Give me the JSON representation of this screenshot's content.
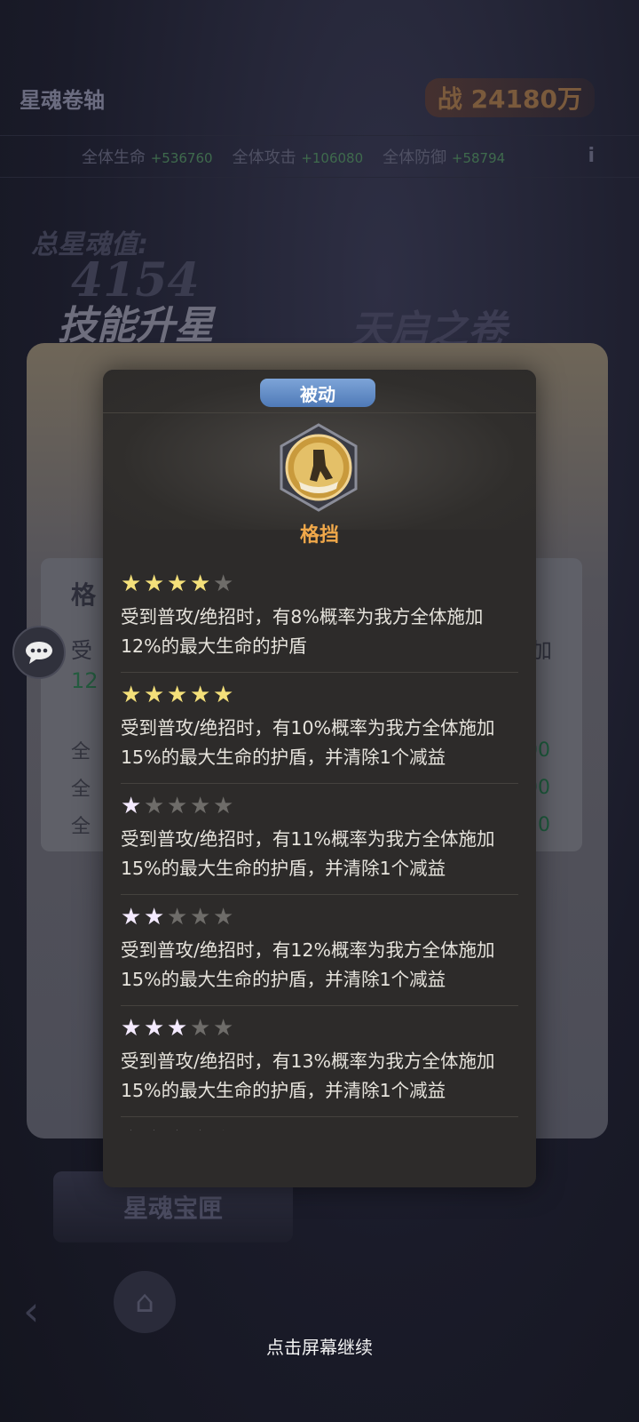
{
  "header": {
    "title": "星魂卷轴",
    "power": "战 24180万"
  },
  "stats": [
    {
      "label": "全体生命",
      "value": "+536760"
    },
    {
      "label": "全体攻击",
      "value": "+106080"
    },
    {
      "label": "全体防御",
      "value": "+58794"
    }
  ],
  "background": {
    "total_label": "总星魂值:",
    "total_value": "4154",
    "skill_up_title": "技能升星",
    "scroll_title": "天启之卷",
    "card_title": "格",
    "card_desc_start": "受",
    "card_desc_end": "加",
    "card_green": "12",
    "rows": [
      {
        "label": "全",
        "value": "00"
      },
      {
        "label": "全",
        "value": "00"
      },
      {
        "label": "全",
        "value": "20"
      }
    ],
    "emblem": "星魂宝匣"
  },
  "popup": {
    "type_tag": "被动",
    "skill_name": "格挡",
    "levels": [
      {
        "stars_filled": 4,
        "stars_total": 5,
        "star_color": "#f4e07a",
        "desc": "受到普攻/绝招时，有8%概率为我方全体施加12%的最大生命的护盾"
      },
      {
        "stars_filled": 5,
        "stars_total": 5,
        "star_color": "#f4e07a",
        "desc": "受到普攻/绝招时，有10%概率为我方全体施加15%的最大生命的护盾，并清除1个减益"
      },
      {
        "stars_filled": 1,
        "stars_total": 5,
        "star_color": "#f4eaff",
        "desc": "受到普攻/绝招时，有11%概率为我方全体施加15%的最大生命的护盾，并清除1个减益"
      },
      {
        "stars_filled": 2,
        "stars_total": 5,
        "star_color": "#f4eaff",
        "desc": "受到普攻/绝招时，有12%概率为我方全体施加15%的最大生命的护盾，并清除1个减益"
      },
      {
        "stars_filled": 3,
        "stars_total": 5,
        "star_color": "#f4eaff",
        "desc": "受到普攻/绝招时，有13%概率为我方全体施加15%的最大生命的护盾，并清除1个减益"
      },
      {
        "stars_filled": 4,
        "stars_total": 5,
        "star_color": "#f4eaff",
        "desc": ""
      }
    ]
  },
  "footer": {
    "continue_text": "点击屏幕继续"
  },
  "icons": {
    "chat": "chat-bubble-icon",
    "back": "back-arrow-icon",
    "home": "home-icon",
    "info": "info-icon",
    "star": "star-icon"
  },
  "colors": {
    "accent_orange": "#f0a84a",
    "tag_blue": "#5f8cc9",
    "star_gold": "#f4e07a"
  }
}
